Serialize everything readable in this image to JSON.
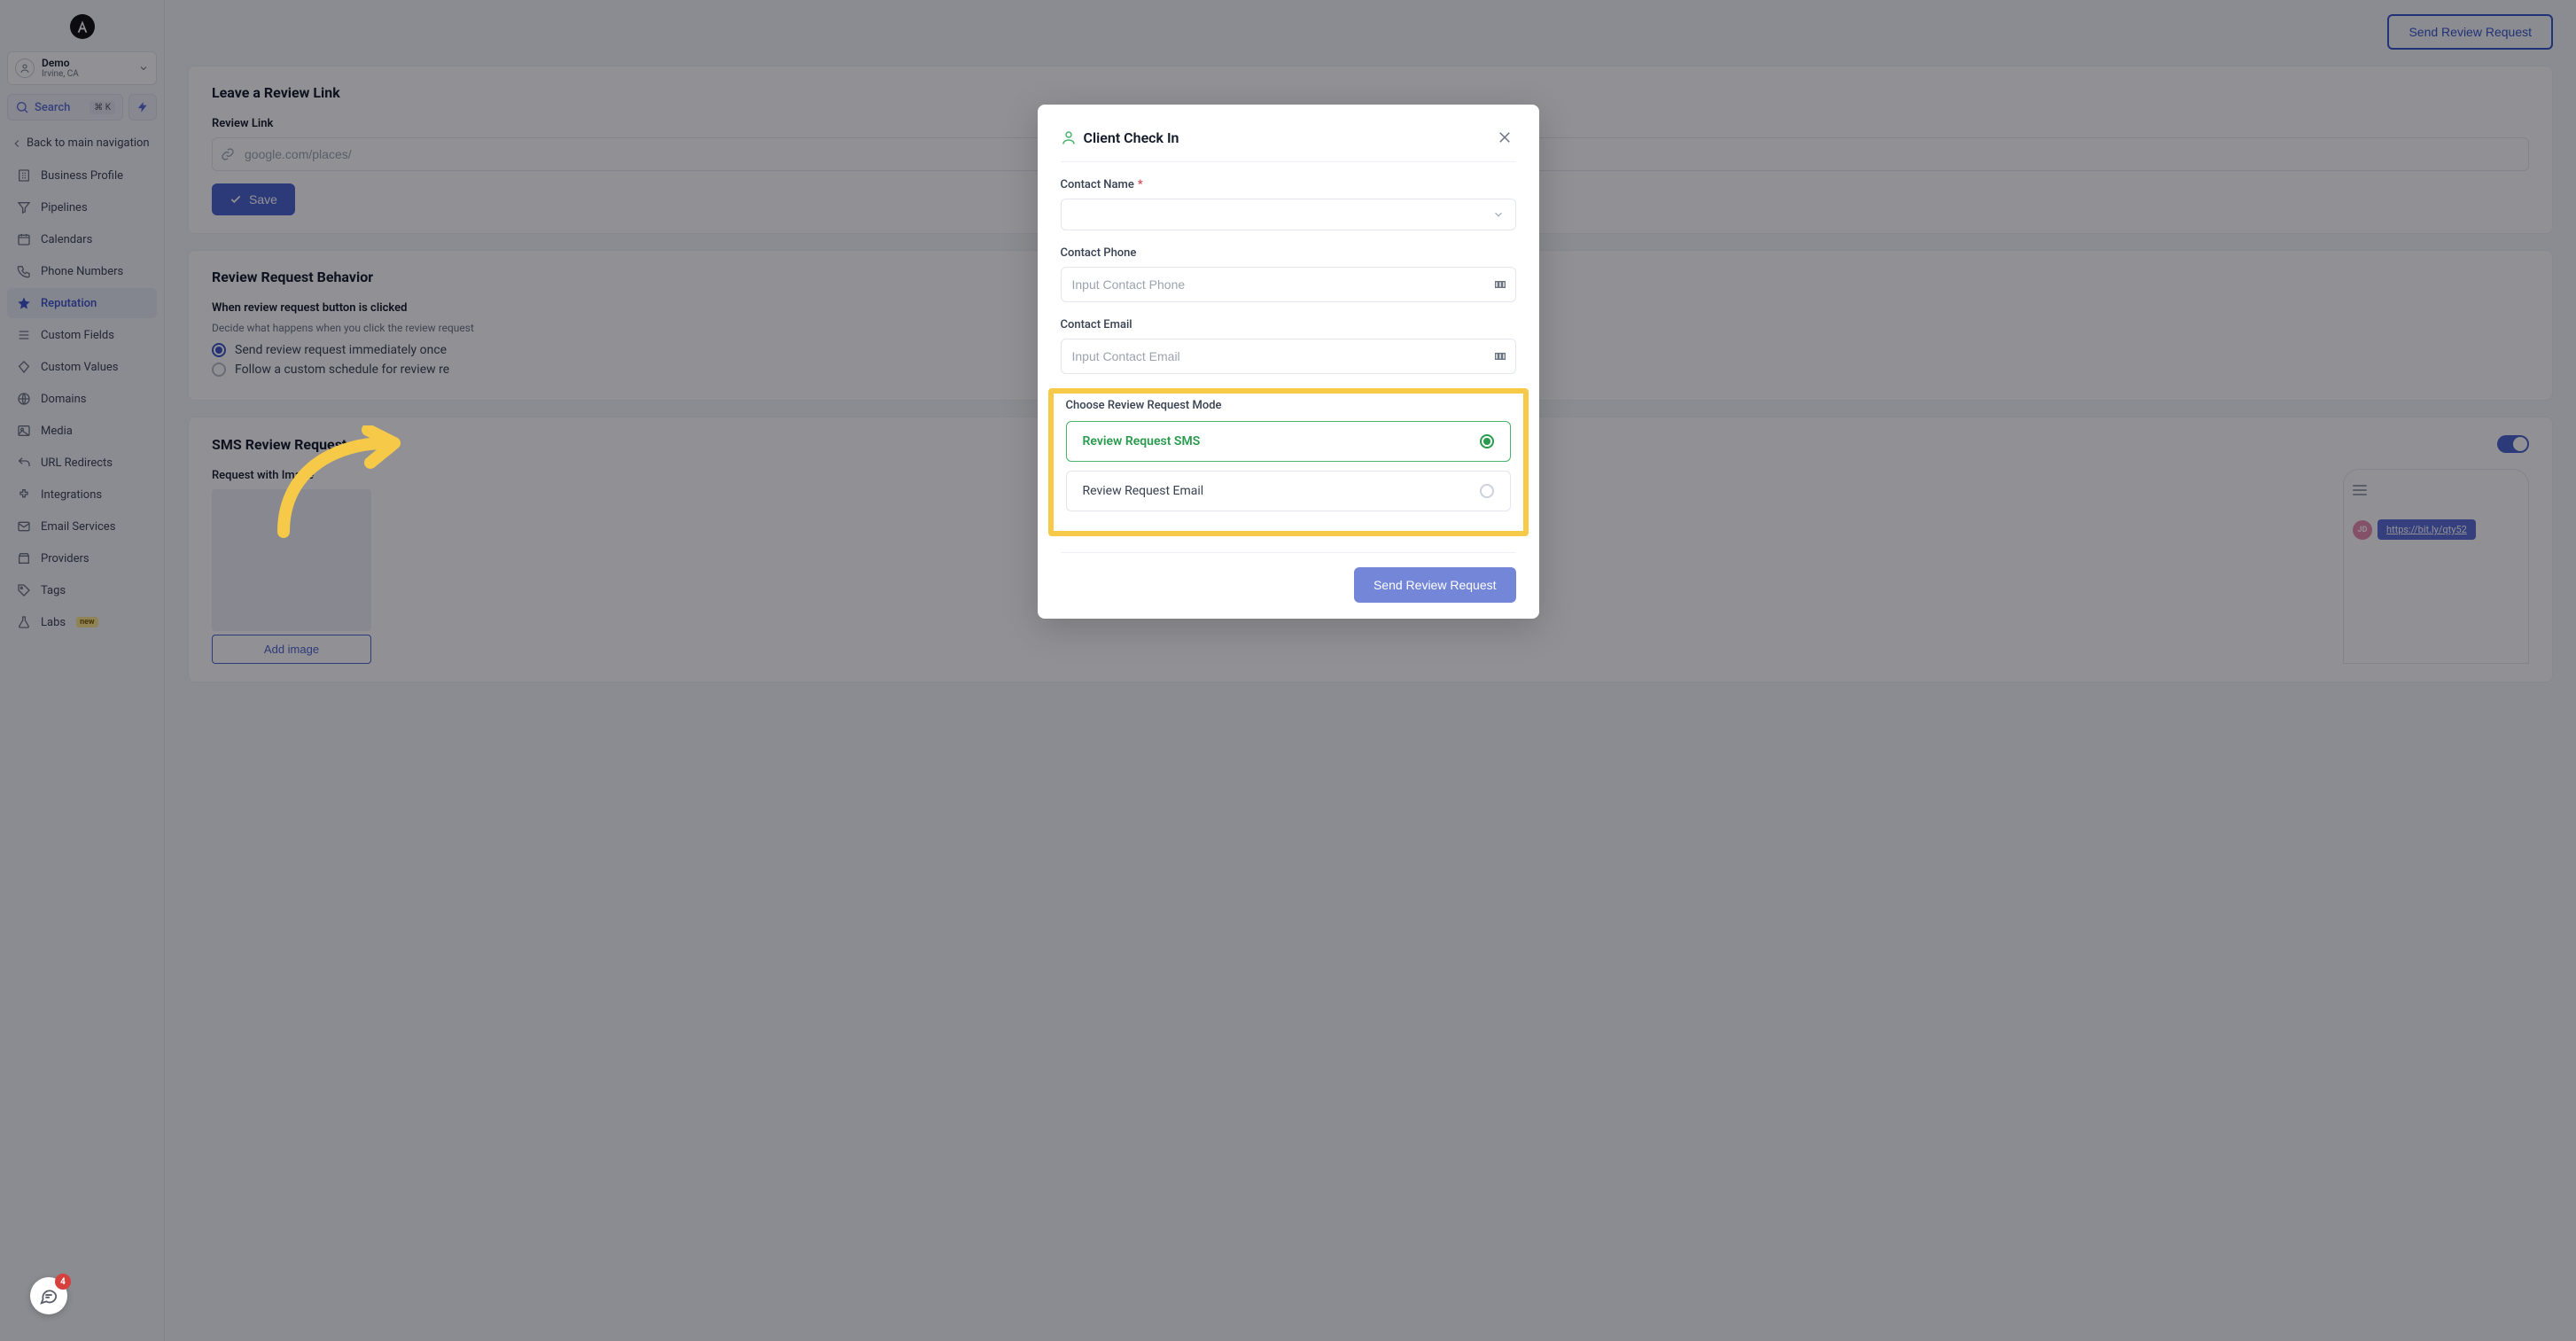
{
  "org": {
    "name": "Demo",
    "sub": "Irvine, CA"
  },
  "search": {
    "label": "Search",
    "shortcut": "⌘ K"
  },
  "back_nav": "Back to main navigation",
  "sidebar": {
    "items": [
      {
        "label": "Business Profile"
      },
      {
        "label": "Pipelines"
      },
      {
        "label": "Calendars"
      },
      {
        "label": "Phone Numbers"
      },
      {
        "label": "Reputation"
      },
      {
        "label": "Custom Fields"
      },
      {
        "label": "Custom Values"
      },
      {
        "label": "Domains"
      },
      {
        "label": "Media"
      },
      {
        "label": "URL Redirects"
      },
      {
        "label": "Integrations"
      },
      {
        "label": "Email Services"
      },
      {
        "label": "Providers"
      },
      {
        "label": "Tags"
      },
      {
        "label": "Labs"
      }
    ],
    "new_badge": "new"
  },
  "top": {
    "send_btn": "Send Review Request"
  },
  "review_link": {
    "title": "Leave a Review Link",
    "label": "Review Link",
    "placeholder": "google.com/places/",
    "save": "Save"
  },
  "behavior": {
    "title": "Review Request Behavior",
    "heading": "When review request button is clicked",
    "sub": "Decide what happens when you click the review request",
    "opt1": "Send review request immediately once",
    "opt2": "Follow a custom schedule for review re"
  },
  "sms": {
    "title": "SMS Review Requests",
    "image_label": "Request with Image",
    "add_image": "Add image",
    "preview_initials": "JD",
    "preview_link": "https://bit.ly/qty52"
  },
  "modal": {
    "title": "Client Check In",
    "contact_name": "Contact Name",
    "required_mark": "*",
    "contact_phone": "Contact Phone",
    "phone_placeholder": "Input Contact Phone",
    "contact_email": "Contact Email",
    "email_placeholder": "Input Contact Email",
    "mode_label": "Choose Review Request Mode",
    "mode_sms": "Review Request SMS",
    "mode_email": "Review Request Email",
    "send_btn": "Send Review Request"
  },
  "chat_badge": "4"
}
